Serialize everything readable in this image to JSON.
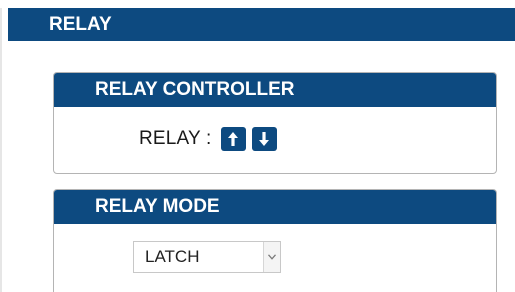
{
  "header": {
    "title": "RELAY"
  },
  "relay_controller": {
    "title": "RELAY CONTROLLER",
    "label": "RELAY :",
    "icons": {
      "up": "arrow-up-icon",
      "down": "arrow-down-icon"
    }
  },
  "relay_mode": {
    "title": "RELAY MODE",
    "selected": "LATCH"
  },
  "colors": {
    "header_bg": "#0d4a80",
    "header_text": "#ffffff",
    "panel_border": "#b4b4b4"
  }
}
